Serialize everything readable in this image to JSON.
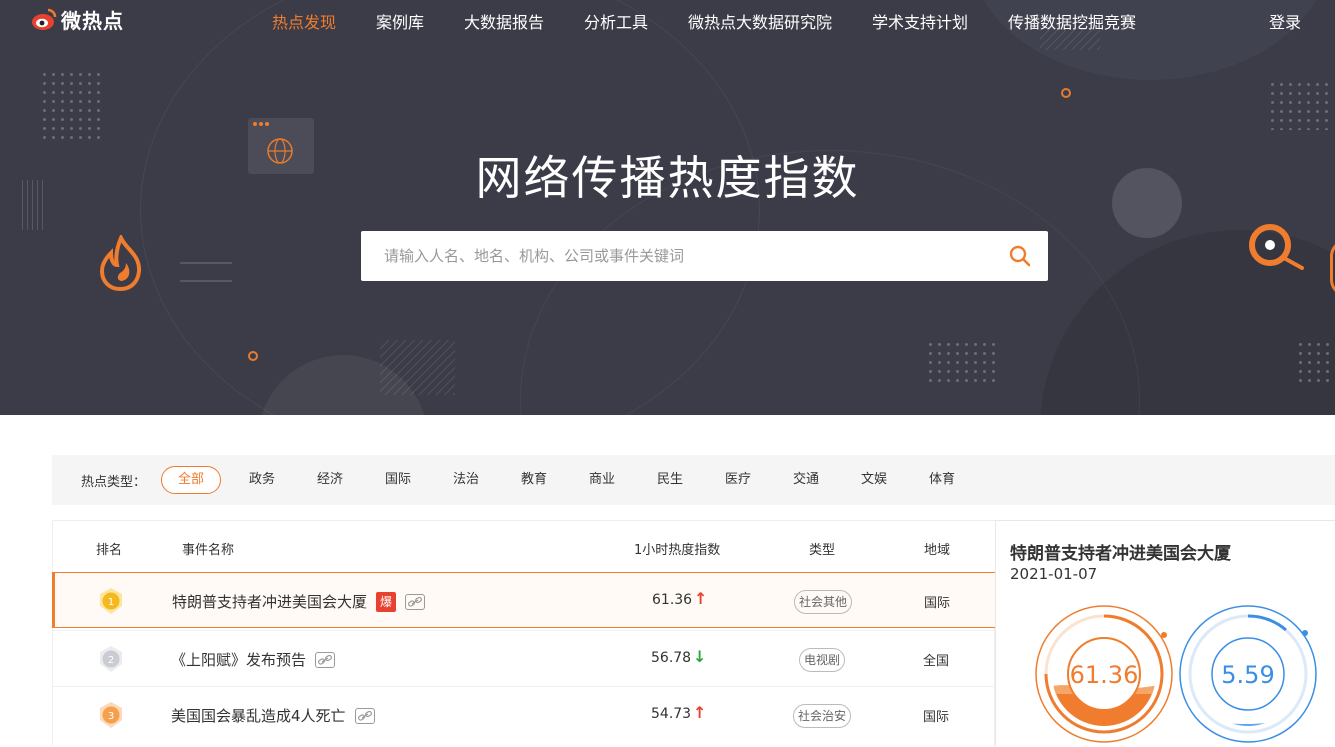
{
  "nav": {
    "logo_text": "微热点",
    "items": [
      "热点发现",
      "案例库",
      "大数据报告",
      "分析工具",
      "微热点大数据研究院",
      "学术支持计划",
      "传播数据挖掘竞赛"
    ],
    "login": "登录"
  },
  "hero": {
    "title": "网络传播热度指数",
    "search_placeholder": "请输入人名、地名、机构、公司或事件关键词"
  },
  "filter": {
    "label": "热点类型：",
    "chips": [
      "全部",
      "政务",
      "经济",
      "国际",
      "法治",
      "教育",
      "商业",
      "民生",
      "医疗",
      "交通",
      "文娱",
      "体育"
    ],
    "active": "全部"
  },
  "table": {
    "headers": {
      "rank": "排名",
      "event": "事件名称",
      "index": "1小时热度指数",
      "type": "类型",
      "region": "地域"
    },
    "rows": [
      {
        "rank": "1",
        "event": "特朗普支持者冲进美国会大厦",
        "badge": "爆",
        "index": "61.36",
        "trend": "↑",
        "type": "社会其他",
        "region": "国际"
      },
      {
        "rank": "2",
        "event": "《上阳赋》发布预告",
        "badge": "",
        "index": "56.78",
        "trend": "↓",
        "type": "电视剧",
        "region": "全国"
      },
      {
        "rank": "3",
        "event": "美国国会暴乱造成4人死亡",
        "badge": "",
        "index": "54.73",
        "trend": "↑",
        "type": "社会治安",
        "region": "国际"
      }
    ]
  },
  "side": {
    "title": "特朗普支持者冲进美国会大厦",
    "date": "2021-01-07",
    "gauges": [
      {
        "value": "61.36",
        "color": "#f07c2e"
      },
      {
        "value": "5.59",
        "color": "#3a8ee6"
      }
    ]
  },
  "colors": {
    "accent": "#f07c2e",
    "hero_bg": "#3b3c48",
    "up": "#e8412f",
    "down": "#2aa636",
    "blue": "#3a8ee6"
  }
}
